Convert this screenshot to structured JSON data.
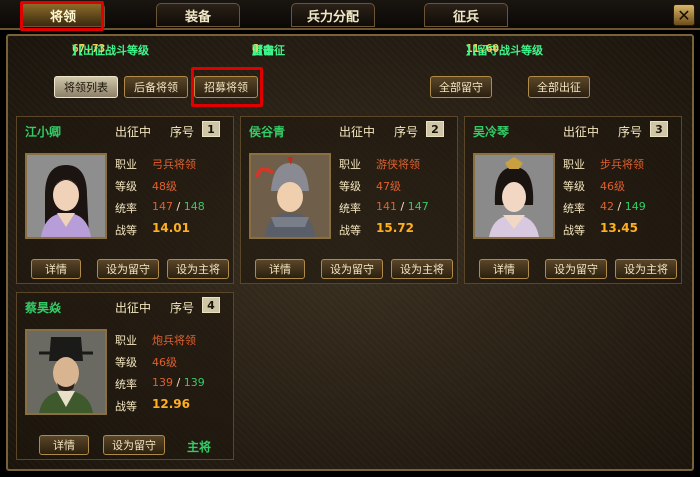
{
  "tabs": [
    {
      "label": "将领",
      "active": true
    },
    {
      "label": "装备",
      "active": false
    },
    {
      "label": "兵力分配",
      "active": false
    },
    {
      "label": "征兵",
      "active": false
    }
  ],
  "close_icon": "close-icon",
  "stats": {
    "march_level_label": "【出征战斗等级",
    "march_level_value": "67.73",
    "march_level_end": "】",
    "counts_open": "【出征",
    "march_count": "4",
    "slash1": "/",
    "guard_label": "留守",
    "guard_count": "0",
    "slash2": "/",
    "reserve_label": "后备",
    "reserve_count": "0",
    "counts_end": "】",
    "guard_level_label": "【留守战斗等级",
    "guard_level_value": "11.60",
    "guard_level_end": "】"
  },
  "buttons": {
    "general_list": "将领列表",
    "reserve_generals": "后备将领",
    "recruit_generals": "招募将领",
    "all_guard": "全部留守",
    "all_march": "全部出征"
  },
  "labels": {
    "status": "出征中",
    "seq": "序号",
    "job": "职业",
    "level": "等级",
    "command": "统率",
    "power": "战等",
    "detail": "详情",
    "set_guard": "设为留守",
    "set_main": "设为主将",
    "main_general": "主将"
  },
  "generals": [
    {
      "name": "江小卿",
      "seq": "1",
      "job": "弓兵将领",
      "level": "48级",
      "command": "147",
      "command_max": "148",
      "power": "14.01"
    },
    {
      "name": "侯谷青",
      "seq": "2",
      "job": "游侠将领",
      "level": "47级",
      "command": "141",
      "command_max": "147",
      "power": "15.72"
    },
    {
      "name": "吴冷琴",
      "seq": "3",
      "job": "步兵将领",
      "level": "46级",
      "command": "42",
      "command_max": "149",
      "power": "13.45"
    },
    {
      "name": "蔡昊焱",
      "seq": "4",
      "job": "炮兵将领",
      "level": "46级",
      "command": "139",
      "command_max": "139",
      "power": "12.96"
    }
  ]
}
